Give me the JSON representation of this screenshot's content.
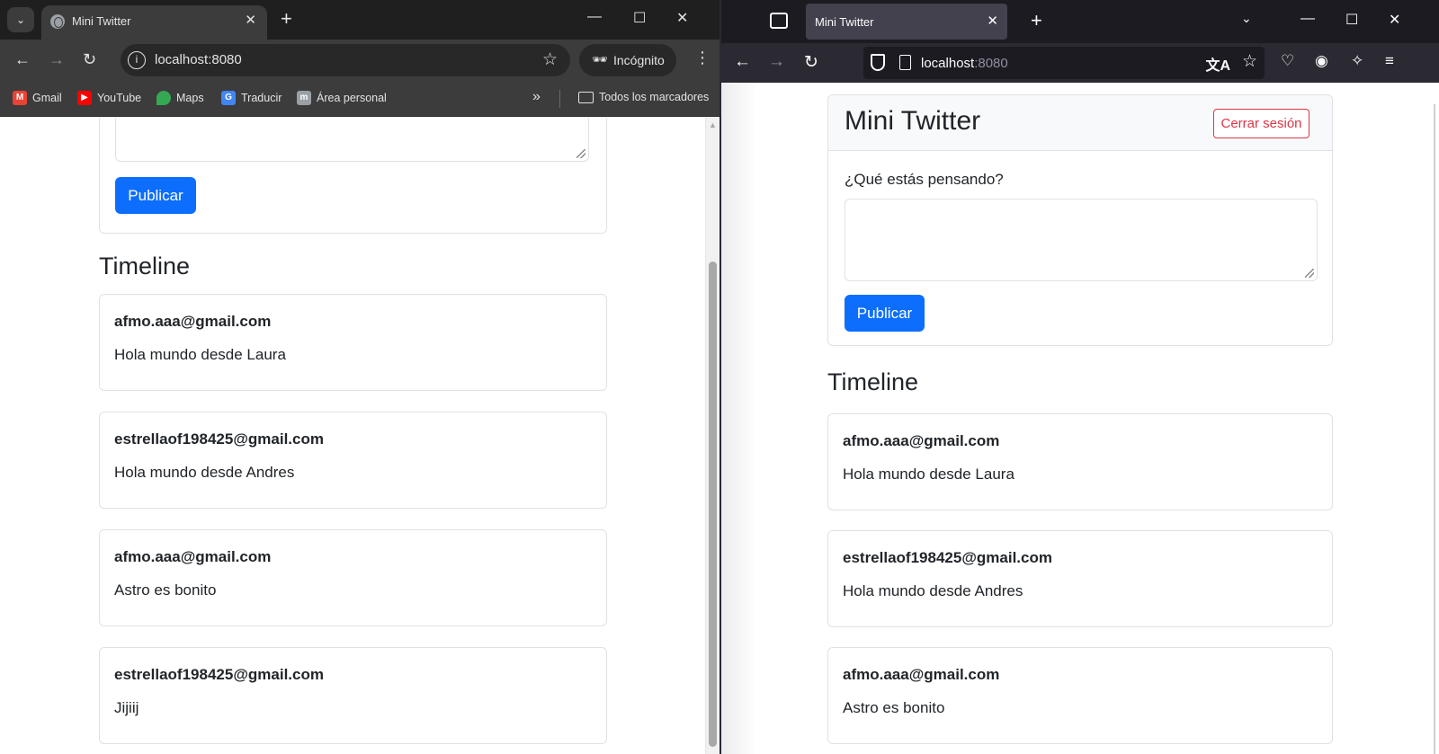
{
  "chrome": {
    "tab_title": "Mini Twitter",
    "url": "localhost:8080",
    "incognito_label": "Incógnito",
    "bookmarks": [
      {
        "label": "Gmail",
        "color": "#ea4335"
      },
      {
        "label": "YouTube",
        "color": "#ff0000"
      },
      {
        "label": "Maps",
        "color": "#34a853"
      },
      {
        "label": "Traducir",
        "color": "#4285f4"
      },
      {
        "label": "Área personal",
        "color": "#9aa0a6"
      }
    ],
    "all_bookmarks_label": "Todos los marcadores",
    "page": {
      "publish_label": "Publicar",
      "timeline_title": "Timeline",
      "posts": [
        {
          "author": "afmo.aaa@gmail.com",
          "text": "Hola mundo desde Laura"
        },
        {
          "author": "estrellaof198425@gmail.com",
          "text": "Hola mundo desde Andres"
        },
        {
          "author": "afmo.aaa@gmail.com",
          "text": "Astro es bonito"
        },
        {
          "author": "estrellaof198425@gmail.com",
          "text": "Jijiij"
        }
      ]
    }
  },
  "firefox": {
    "tab_title": "Mini Twitter",
    "url_host": "localhost",
    "url_port": ":8080",
    "page": {
      "brand": "Mini Twitter",
      "logout_label": "Cerrar sesión",
      "prompt_label": "¿Qué estás pensando?",
      "publish_label": "Publicar",
      "timeline_title": "Timeline",
      "posts": [
        {
          "author": "afmo.aaa@gmail.com",
          "text": "Hola mundo desde Laura"
        },
        {
          "author": "estrellaof198425@gmail.com",
          "text": "Hola mundo desde Andres"
        },
        {
          "author": "afmo.aaa@gmail.com",
          "text": "Astro es bonito"
        }
      ]
    }
  },
  "colors": {
    "primary": "#0d6efd",
    "danger": "#dc3545",
    "chrome_dark": "#3c3c3c",
    "firefox_dark": "#2b2a33"
  }
}
